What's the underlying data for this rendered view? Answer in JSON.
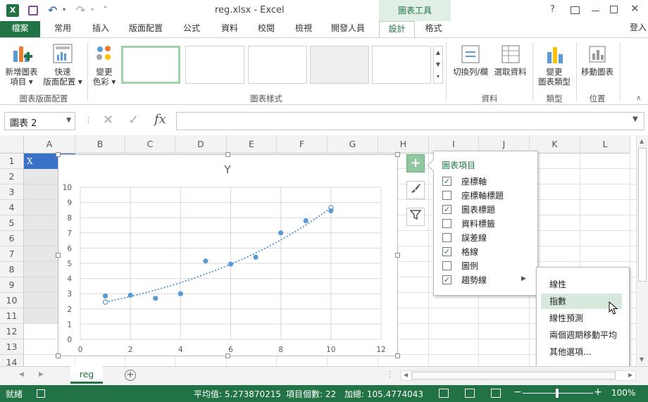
{
  "window": {
    "title": "reg.xlsx - Excel",
    "context_tab_group": "圖表工具",
    "sign_in": "登入"
  },
  "tabs": [
    {
      "label": "檔案"
    },
    {
      "label": "常用"
    },
    {
      "label": "插入"
    },
    {
      "label": "版面配置"
    },
    {
      "label": "公式"
    },
    {
      "label": "資料"
    },
    {
      "label": "校閱"
    },
    {
      "label": "檢視"
    },
    {
      "label": "開發人員"
    },
    {
      "label": "設計"
    },
    {
      "label": "格式"
    }
  ],
  "ribbon": {
    "add_element_l1": "新增圖表",
    "add_element_l2": "項目 ▾",
    "quick_layout_l1": "快速",
    "quick_layout_l2": "版面配置 ▾",
    "change_colors_l1": "變更",
    "change_colors_l2": "色彩 ▾",
    "group_layouts": "圖表版面配置",
    "group_styles": "圖表樣式",
    "switch_row_col": "切換列/欄",
    "select_data": "選取資料",
    "group_data": "資料",
    "change_type_l1": "變更",
    "change_type_l2": "圖表類型",
    "group_type": "類型",
    "move_chart": "移動圖表",
    "group_location": "位置"
  },
  "formula_bar": {
    "name_box": "圖表 2",
    "formula": ""
  },
  "columns": [
    "A",
    "B",
    "C",
    "D",
    "E",
    "F",
    "G",
    "H",
    "I",
    "J",
    "K",
    "L"
  ],
  "rows": [
    "1",
    "2",
    "3",
    "4",
    "5",
    "6",
    "7",
    "8",
    "9",
    "10",
    "11",
    "12",
    "13",
    "14"
  ],
  "cell_A1": "X",
  "chart_data": {
    "type": "scatter",
    "title": "Y",
    "xlim": [
      0,
      12
    ],
    "ylim": [
      0,
      10
    ],
    "x_ticks": [
      "0",
      "2",
      "4",
      "6",
      "8",
      "10",
      "12"
    ],
    "y_ticks": [
      "0",
      "1",
      "2",
      "3",
      "4",
      "5",
      "6",
      "7",
      "8",
      "9",
      "10"
    ],
    "gridlines": true,
    "series": [
      {
        "x": [
          1,
          2,
          3,
          4,
          5,
          6,
          7,
          8,
          9,
          10
        ],
        "y": [
          2.85,
          2.9,
          2.7,
          3.0,
          5.15,
          4.95,
          5.4,
          7.0,
          7.8,
          8.45
        ]
      }
    ],
    "trendline": {
      "type": "exponential",
      "start_y": 2.45,
      "end_y": 8.65
    },
    "colors": {
      "marker": "#5b9bd5"
    }
  },
  "chart_elements_panel": {
    "title": "圖表項目",
    "items": [
      {
        "label": "座標軸",
        "checked": true
      },
      {
        "label": "座標軸標題",
        "checked": false
      },
      {
        "label": "圖表標題",
        "checked": true
      },
      {
        "label": "資料標籤",
        "checked": false
      },
      {
        "label": "誤差線",
        "checked": false
      },
      {
        "label": "格線",
        "checked": true
      },
      {
        "label": "圖例",
        "checked": false
      },
      {
        "label": "趨勢線",
        "checked": true
      }
    ]
  },
  "trendline_submenu": {
    "items": [
      "線性",
      "指數",
      "線性預測",
      "兩個週期移動平均",
      "其他選項..."
    ],
    "highlighted": "指數"
  },
  "sheet_tab": "reg",
  "status": {
    "ready": "就緒",
    "average": "平均值: 5.273870215",
    "count": "項目個數: 22",
    "sum": "加總: 105.4774043",
    "zoom": "100%"
  }
}
